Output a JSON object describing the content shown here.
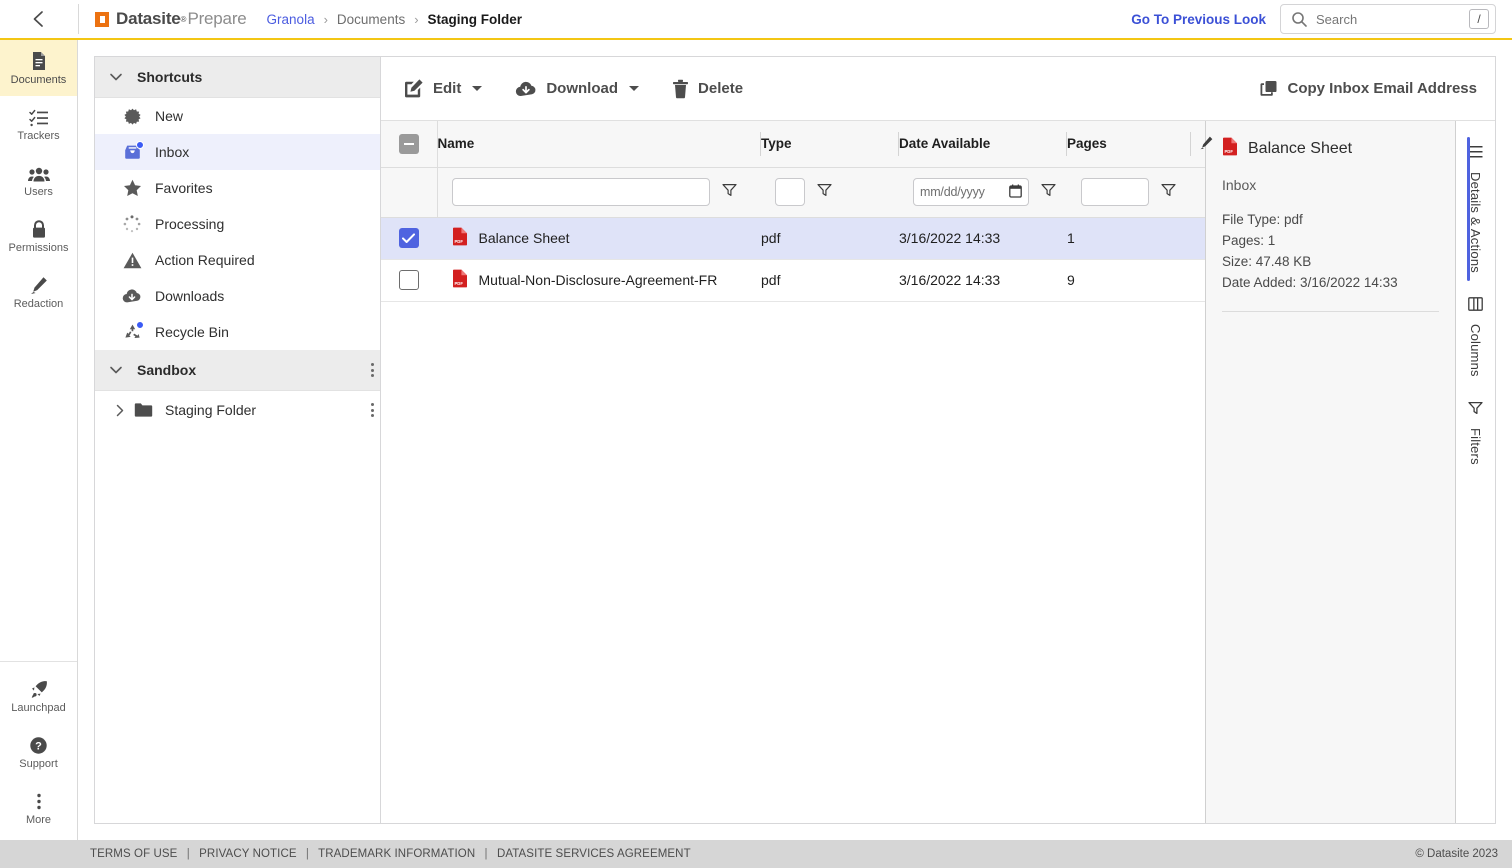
{
  "header": {
    "back_icon": "chevron-left-icon",
    "brand_bold": "Datasite",
    "brand_sup": "®",
    "brand_light": "Prepare",
    "breadcrumb": [
      {
        "label": "Granola",
        "type": "link"
      },
      {
        "label": "Documents",
        "type": "link-muted"
      },
      {
        "label": "Staging Folder",
        "type": "current"
      }
    ],
    "breadcrumb_separator": "›",
    "previous_look_label": "Go To Previous Look",
    "search": {
      "icon": "search-icon",
      "placeholder": "Search",
      "shortcut_key": "/"
    },
    "accent_color": "#f3c614"
  },
  "rail": {
    "top_items": [
      {
        "label": "Documents",
        "icon": "document-icon",
        "active": true
      },
      {
        "label": "Trackers",
        "icon": "checklist-icon",
        "active": false
      },
      {
        "label": "Users",
        "icon": "users-icon",
        "active": false
      },
      {
        "label": "Permissions",
        "icon": "lock-icon",
        "active": false
      },
      {
        "label": "Redaction",
        "icon": "highlighter-icon",
        "active": false
      }
    ],
    "bottom_items": [
      {
        "label": "Launchpad",
        "icon": "rocket-icon"
      },
      {
        "label": "Support",
        "icon": "question-circle-icon"
      },
      {
        "label": "More",
        "icon": "kebab-icon"
      }
    ]
  },
  "tree": {
    "shortcuts": {
      "title": "Shortcuts",
      "expanded": true,
      "items": [
        {
          "label": "New",
          "icon": "burst-icon",
          "badge": false,
          "selected": false
        },
        {
          "label": "Inbox",
          "icon": "inbox-icon",
          "badge": true,
          "selected": true
        },
        {
          "label": "Favorites",
          "icon": "star-icon",
          "badge": false,
          "selected": false
        },
        {
          "label": "Processing",
          "icon": "spinner-icon",
          "badge": false,
          "selected": false
        },
        {
          "label": "Action Required",
          "icon": "warning-triangle-icon",
          "badge": false,
          "selected": false
        },
        {
          "label": "Downloads",
          "icon": "cloud-download-icon",
          "badge": false,
          "selected": false
        },
        {
          "label": "Recycle Bin",
          "icon": "recycle-icon",
          "badge": true,
          "selected": false
        }
      ]
    },
    "sandbox": {
      "title": "Sandbox",
      "expanded": true,
      "folders": [
        {
          "label": "Staging Folder",
          "icon": "folder-icon",
          "expanded": false
        }
      ]
    }
  },
  "toolbar": {
    "edit_label": "Edit",
    "download_label": "Download",
    "delete_label": "Delete",
    "copy_inbox_label": "Copy Inbox Email Address",
    "edit_icon": "edit-pencil-icon",
    "download_icon": "cloud-download-icon",
    "delete_icon": "trash-icon",
    "copy_icon": "copy-icon"
  },
  "table": {
    "select_all_state": "indeterminate",
    "columns": [
      {
        "key": "name",
        "label": "Name"
      },
      {
        "key": "type",
        "label": "Type"
      },
      {
        "key": "date",
        "label": "Date Available"
      },
      {
        "key": "pages",
        "label": "Pages"
      }
    ],
    "filters": {
      "name_value": "",
      "type_value": "",
      "date_placeholder": "mm/dd/yyyy",
      "pages_value": "",
      "filter_icon": "funnel-icon",
      "calendar_icon": "calendar-icon"
    },
    "rows": [
      {
        "checked": true,
        "selected": true,
        "icon": "pdf-file-icon",
        "name": "Balance Sheet",
        "type": "pdf",
        "date": "3/16/2022 14:33",
        "pages": "1"
      },
      {
        "checked": false,
        "selected": false,
        "icon": "pdf-file-icon",
        "name": "Mutual-Non-Disclosure-Agreement-FR",
        "type": "pdf",
        "date": "3/16/2022 14:33",
        "pages": "9"
      }
    ]
  },
  "details": {
    "file_icon": "pdf-file-icon",
    "title": "Balance Sheet",
    "location": "Inbox",
    "fields": [
      "File Type: pdf",
      "Pages: 1",
      "Size: 47.48 KB",
      "Date Added: 3/16/2022 14:33"
    ]
  },
  "vtabs": [
    {
      "label": "Details & Actions",
      "icon": "list-lines-icon",
      "active": true
    },
    {
      "label": "Columns",
      "icon": "columns-icon",
      "active": false
    },
    {
      "label": "Filters",
      "icon": "funnel-icon",
      "active": false
    }
  ],
  "footer": {
    "links": [
      "TERMS OF USE",
      "PRIVACY NOTICE",
      "TRADEMARK INFORMATION",
      "DATASITE SERVICES AGREEMENT"
    ],
    "separator": "|",
    "copyright": "© Datasite 2023"
  },
  "colors": {
    "accent_yellow": "#f3c614",
    "brand_orange": "#ec7211",
    "link_blue": "#3b50d6",
    "select_blue": "#4f63e0",
    "row_selected": "#dfe3f8",
    "pdf_red": "#d32020"
  }
}
